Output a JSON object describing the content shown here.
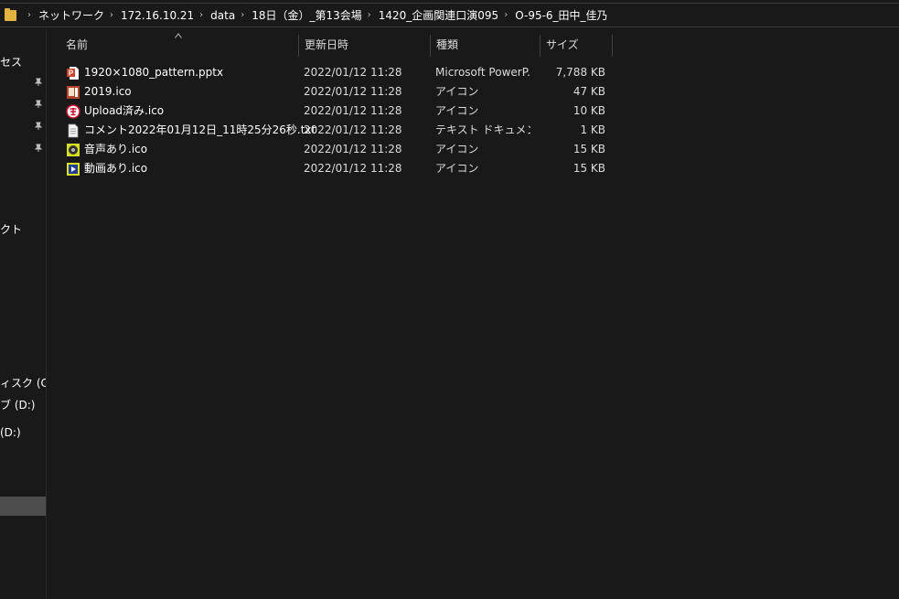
{
  "address_bar": {
    "crumbs": [
      "ネットワーク",
      "172.16.10.21",
      "data",
      "18日（金）_第13会場",
      "1420_企画関連口演095",
      "O-95-6_田中_佳乃"
    ]
  },
  "nav": {
    "items": [
      "セス",
      "クト",
      "ィスク (C:)",
      "ブ (D:)",
      "(D:)"
    ]
  },
  "columns": {
    "name": "名前",
    "date": "更新日時",
    "type": "種類",
    "size": "サイズ"
  },
  "files": [
    {
      "name": "1920×1080_pattern.pptx",
      "date": "2022/01/12 11:28",
      "type": "Microsoft PowerP...",
      "size": "7,788 KB",
      "icon": "powerpoint-file-icon"
    },
    {
      "name": "2019.ico",
      "date": "2022/01/12 11:28",
      "type": "アイコン",
      "size": "47 KB",
      "icon": "ico-2019-icon"
    },
    {
      "name": "Upload済み.ico",
      "date": "2022/01/12 11:28",
      "type": "アイコン",
      "size": "10 KB",
      "icon": "uploaded-stamp-icon"
    },
    {
      "name": "コメント2022年01月12日_11時25分26秒.txt",
      "date": "2022/01/12 11:28",
      "type": "テキスト ドキュメント",
      "size": "1 KB",
      "icon": "text-file-icon"
    },
    {
      "name": "音声あり.ico",
      "date": "2022/01/12 11:28",
      "type": "アイコン",
      "size": "15 KB",
      "icon": "audio-icon"
    },
    {
      "name": "動画あり.ico",
      "date": "2022/01/12 11:28",
      "type": "アイコン",
      "size": "15 KB",
      "icon": "video-icon"
    }
  ],
  "colors": {
    "background": "#191919",
    "selection": "#4d4d4d",
    "folder": "#e3b341"
  }
}
